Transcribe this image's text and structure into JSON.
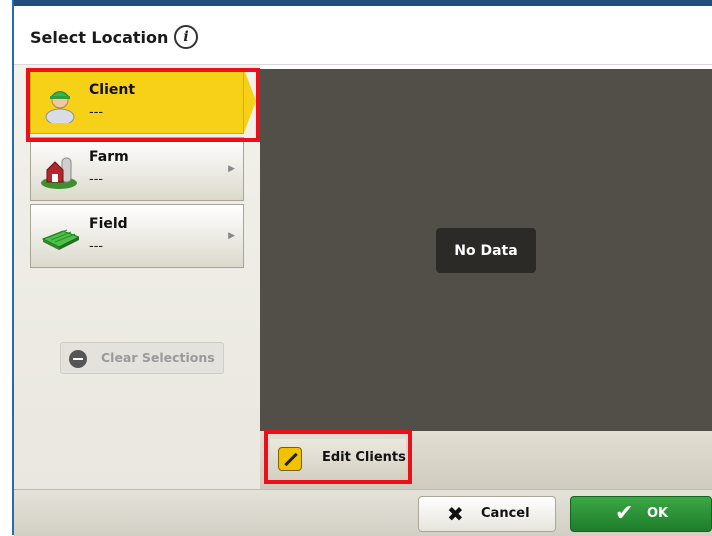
{
  "dialog": {
    "title": "Select Location",
    "info_icon": "info-icon"
  },
  "nav": {
    "items": [
      {
        "label": "Client",
        "value": "---",
        "icon": "client-person-icon"
      },
      {
        "label": "Farm",
        "value": "---",
        "icon": "farm-barn-icon"
      },
      {
        "label": "Field",
        "value": "---",
        "icon": "field-icon"
      }
    ],
    "clear_label": "Clear Selections"
  },
  "main": {
    "no_data_label": "No Data"
  },
  "edit": {
    "label": "Edit Clients",
    "icon": "pencil-icon"
  },
  "footer": {
    "cancel_label": "Cancel",
    "ok_label": "OK",
    "cancel_glyph": "✖",
    "ok_glyph": "✔"
  },
  "colors": {
    "accent_yellow": "#f7d117",
    "ok_green": "#2a8f36",
    "highlight_red": "#e8111b",
    "panel_dark": "#524e48"
  }
}
